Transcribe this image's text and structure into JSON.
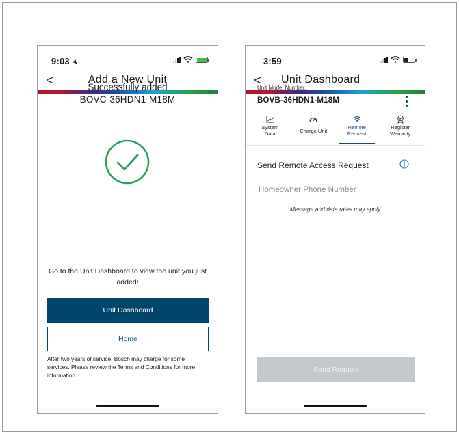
{
  "left_screen": {
    "status_bar": {
      "time": "9:03",
      "battery_color": "#3fc24a"
    },
    "header": {
      "back_label": "<",
      "title": "Add a New Unit"
    },
    "confirmation": {
      "message": "Successfully added",
      "model_number": "BOVC-36HDN1-M18M",
      "icon": "check-circle-icon",
      "icon_color": "#2e9d5c"
    },
    "prompt": "Go to the Unit Dashboard to view the unit you just added!",
    "primary_button": "Unit Dashboard",
    "secondary_button": "Home",
    "disclaimer": "After two years of service, Bosch may charge for some services. Please review the Terms and Conditions for more information."
  },
  "right_screen": {
    "status_bar": {
      "time": "3:59",
      "battery_color": "#1a1a1a"
    },
    "header": {
      "back_label": "<",
      "title": "Unit Dashboard"
    },
    "model_label": "Unit Model Number:",
    "model_value": "BOVB-36HDN1-M18M",
    "tabs": [
      {
        "label_line1": "System",
        "label_line2": "Data",
        "icon": "line-chart-icon",
        "active": false
      },
      {
        "label_line1": "Charge Unit",
        "label_line2": "",
        "icon": "gauge-icon",
        "active": false
      },
      {
        "label_line1": "Remote",
        "label_line2": "Request",
        "icon": "wifi-icon",
        "active": true
      },
      {
        "label_line1": "Register",
        "label_line2": "Warranty",
        "icon": "badge-icon",
        "active": false
      }
    ],
    "form": {
      "title": "Send Remote Access Request",
      "phone_placeholder": "Homeowner Phone Number",
      "phone_value": "",
      "note": "Message and data rates may apply"
    },
    "send_button": "Send Request"
  },
  "colors": {
    "brand_blue": "#00456a",
    "tab_active": "#1b4a78",
    "disabled_button": "#c5c8cb"
  }
}
